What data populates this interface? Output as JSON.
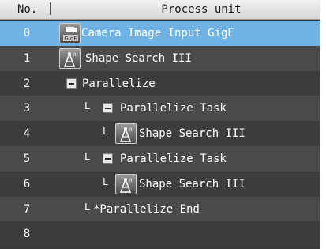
{
  "header": {
    "no_label": "No.",
    "unit_label": "Process unit"
  },
  "rows": [
    {
      "no": "0",
      "branch": "",
      "label": "Camera Image Input GigE",
      "icon": "camera-gige-icon",
      "selected": true
    },
    {
      "no": "1",
      "branch": "",
      "label": "Shape Search III",
      "icon": "shape-search-icon"
    },
    {
      "no": "2",
      "branch": "",
      "label": "Parallelize",
      "icon": "collapse-minus-icon"
    },
    {
      "no": "3",
      "branch": "L",
      "label": "Parallelize Task",
      "icon": "collapse-minus-icon"
    },
    {
      "no": "4",
      "branch": "L",
      "label": "Shape Search III",
      "icon": "shape-search-icon"
    },
    {
      "no": "5",
      "branch": "L",
      "label": "Parallelize Task",
      "icon": "collapse-minus-icon"
    },
    {
      "no": "6",
      "branch": "L",
      "label": "Shape Search III",
      "icon": "shape-search-icon"
    },
    {
      "no": "7",
      "branch": "L",
      "label": "*Parallelize End",
      "icon": ""
    },
    {
      "no": "8",
      "branch": "",
      "label": "",
      "icon": ""
    }
  ],
  "colors": {
    "selected_row": "#6fb2e6",
    "row_dark": "#3d3d3d",
    "row_light": "#4a4a4a"
  }
}
